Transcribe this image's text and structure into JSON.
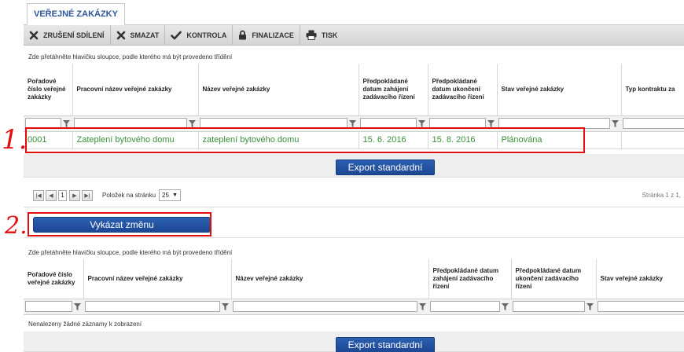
{
  "tab": {
    "title": "VEŘEJNÉ ZAKÁZKY"
  },
  "toolbar": [
    {
      "icon": "close-icon",
      "label": "ZRUŠENÍ SDÍLENÍ"
    },
    {
      "icon": "close-icon",
      "label": "SMAZAT"
    },
    {
      "icon": "check-icon",
      "label": "KONTROLA"
    },
    {
      "icon": "lock-icon",
      "label": "FINALIZACE"
    },
    {
      "icon": "printer-icon",
      "label": "TISK"
    }
  ],
  "grid1": {
    "drag_hint": "Zde přetáhněte hlavičku sloupce, podle kterého má být provedeno třídění",
    "columns": [
      "Pořadové číslo veřejné zakázky",
      "Pracovní název veřejné zakázky",
      "Název veřejné zakázky",
      "Předpokládané datum zahájení zadávacího řízení",
      "Předpokládané datum ukončení zadávacího řízení",
      "Stav veřejné zakázky",
      "Typ kontraktu za"
    ],
    "row": {
      "number": "0001",
      "working_name": "Zateplení bytového domu",
      "name": "zateplení bytového domu",
      "start_date": "15. 6. 2016",
      "end_date": "15. 8. 2016",
      "status": "Plánována"
    },
    "export_label": "Export standardní"
  },
  "pager": {
    "current_page": "1",
    "page_size_label": "Položek na stránku",
    "page_size": "25",
    "page_info": "Stránka 1 z 1,"
  },
  "report_change_label": "Vykázat změnu",
  "grid2": {
    "drag_hint": "Zde přetáhněte hlavičku sloupce, podle kterého má být provedeno třídění",
    "columns": [
      "Pořadové číslo veřejné zakázky",
      "Pracovní název veřejné zakázky",
      "Název veřejné zakázky",
      "Předpokládané datum zahájení zadávacího řízení",
      "Předpokládané datum ukončení zadávacího řízení",
      "Stav veřejné zakázky"
    ],
    "empty_text": "Nenalezeny žádné záznamy k zobrazení",
    "export_label": "Export standardní"
  },
  "annotations": {
    "mark1": "1.",
    "mark2": "2."
  },
  "colors": {
    "annotation": "#e30d0d",
    "button": "#1d4794",
    "row_text": "#3a8f3a"
  }
}
